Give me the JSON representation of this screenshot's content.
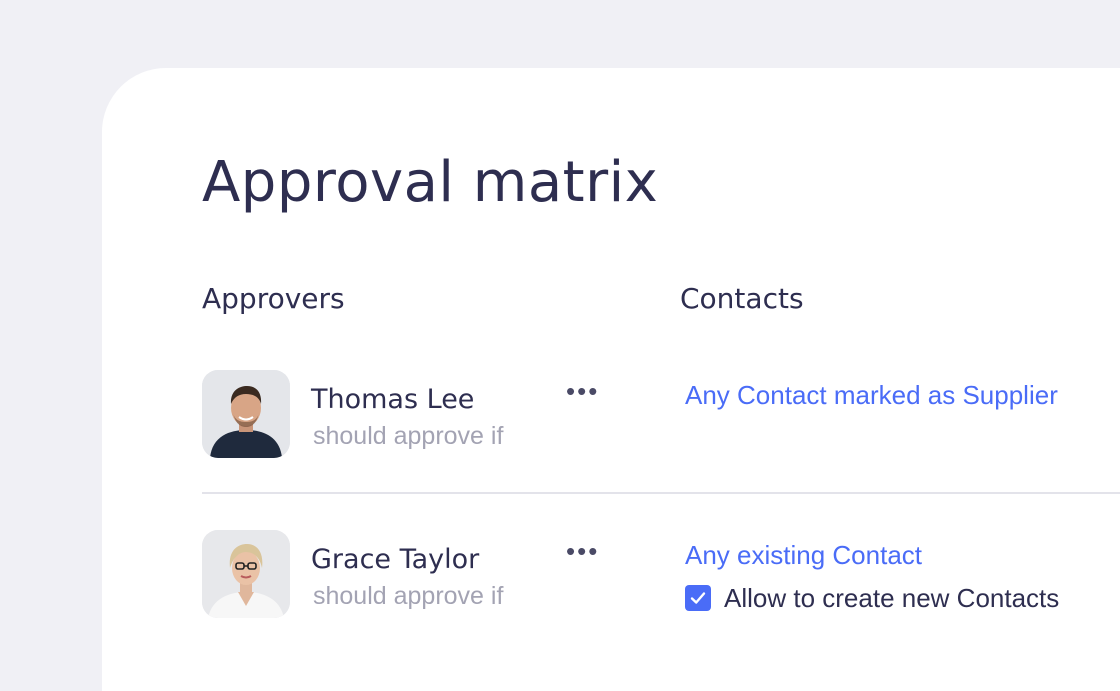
{
  "page": {
    "title": "Approval matrix"
  },
  "columns": {
    "approvers": "Approvers",
    "contacts": "Contacts"
  },
  "rows": [
    {
      "name": "Thomas Lee",
      "condition": "should approve if",
      "menu": "•••",
      "contact_rule": "Any Contact marked as Supplier"
    },
    {
      "name": "Grace Taylor",
      "condition": "should approve if",
      "menu": "•••",
      "contact_rule": "Any existing Contact",
      "checkbox": {
        "label": "Allow to create new Contacts",
        "checked": true
      }
    }
  ],
  "colors": {
    "accent": "#4a6cf7",
    "text_primary": "#2e2e50",
    "text_muted": "#a3a3b3",
    "background": "#f0f0f5"
  },
  "icons": {
    "more": "more-horizontal-icon",
    "check": "checkmark-icon"
  }
}
